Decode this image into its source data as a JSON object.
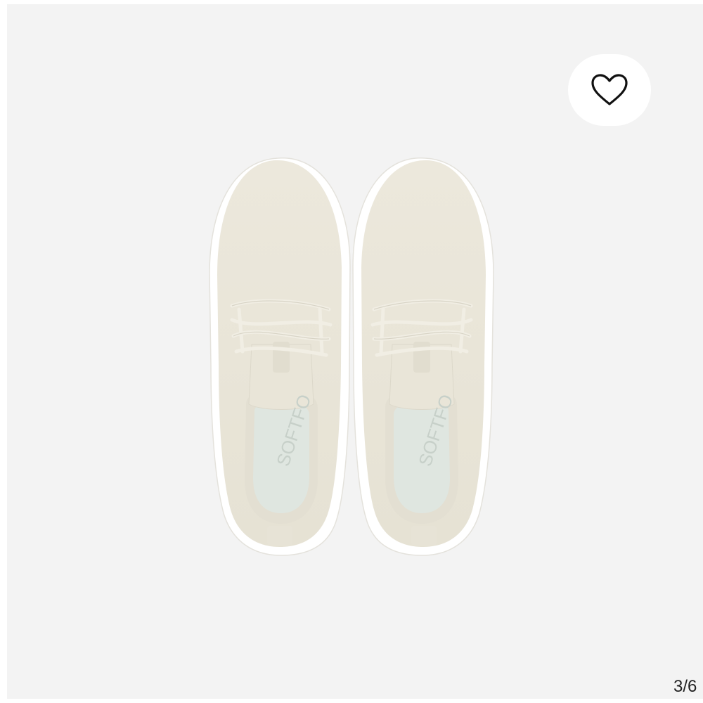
{
  "gallery": {
    "image": {
      "subject": "product-photo-sneakers-top-view",
      "background_color": "#f3f3f3",
      "shoe_color": "#ece8dc",
      "sole_color": "#ffffff",
      "insole_color": "#dfe6e0",
      "insole_text": "SOFTFO"
    },
    "favorite": {
      "icon": "heart-outline-icon",
      "button_color": "#ffffff"
    },
    "counter": {
      "text": "3/6"
    }
  }
}
